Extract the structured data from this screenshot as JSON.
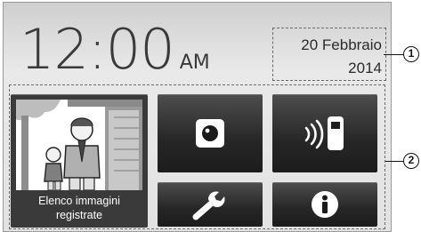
{
  "clock": {
    "time": "12:00",
    "ampm": "AM"
  },
  "date": {
    "line1": "20 Febbraio",
    "line2": "2014"
  },
  "tiles": {
    "album": {
      "line1": "Elenco immagini",
      "line2": "registrate"
    },
    "record": {
      "icon": "record-icon"
    },
    "intercom": {
      "icon": "intercom-phone-icon"
    },
    "settings": {
      "icon": "wrench-icon"
    },
    "info": {
      "icon": "info-icon"
    }
  },
  "callouts": {
    "first": "1",
    "second": "2"
  },
  "colors": {
    "tile": "#262626",
    "background": "#e6e6e6",
    "text": "#3a3a3a"
  }
}
